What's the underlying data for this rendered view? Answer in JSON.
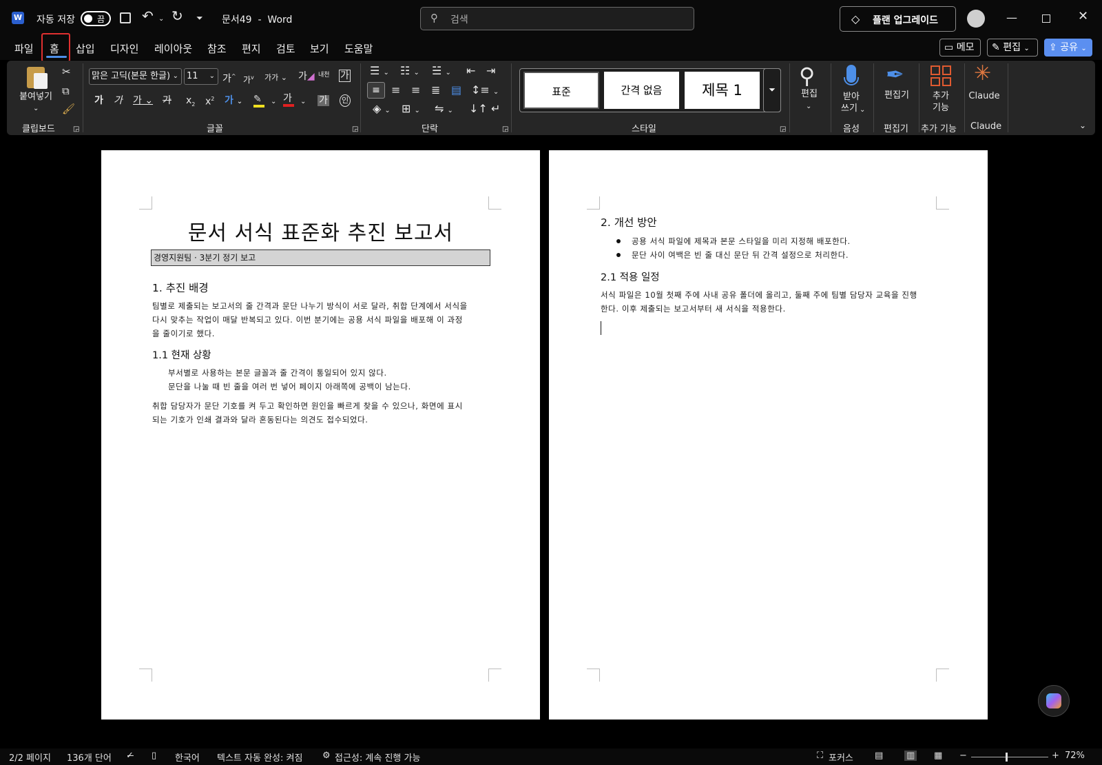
{
  "title_bar": {
    "autosave_label": "자동 저장",
    "autosave_state": "끔",
    "doc_title": "문서49  -  Word",
    "search_placeholder": "검색",
    "upgrade_label": "플랜 업그레이드"
  },
  "menu": {
    "tabs": [
      "파일",
      "홈",
      "삽입",
      "디자인",
      "레이아웃",
      "참조",
      "편지",
      "검토",
      "보기",
      "도움말"
    ],
    "active_tab": "홈",
    "memo_label": "메모",
    "edit_label": "편집",
    "share_label": "공유"
  },
  "ribbon": {
    "clipboard": {
      "paste_label": "붙여넣기",
      "group_label": "클립보드"
    },
    "font": {
      "font_name": "맑은 고딕(본문 한글)",
      "font_size": "11",
      "group_label": "글꼴"
    },
    "paragraph": {
      "group_label": "단락"
    },
    "styles": {
      "items": [
        "표준",
        "간격 없음",
        "제목 1"
      ],
      "group_label": "스타일"
    },
    "editing": {
      "label": "편집"
    },
    "dictate": {
      "label_line1": "받아",
      "label_line2": "쓰기",
      "group_label": "음성"
    },
    "editor": {
      "label": "편집기",
      "group_label": "편집기"
    },
    "addins": {
      "label_line1": "추가",
      "label_line2": "기능",
      "group_label": "추가 기능"
    },
    "claude": {
      "label": "Claude",
      "group_label": "Claude"
    }
  },
  "document": {
    "page1": {
      "title": "문서 서식 표준화 추진 보고서",
      "subtitle": "경영지원팀 · 3분기 정기 보고",
      "h1": "1. 추진 배경",
      "para1_lines": [
        "팀별로 제출되는 보고서의 줄 간격과 문단 나누기 방식이 서로 달라, 취합 단계에서 서식을",
        "다시 맞추는 작업이 매달 반복되고 있다. 이번 분기에는 공용 서식 파일을 배포해 이 과정",
        "을 줄이기로 했다."
      ],
      "h2": "1.1 현재 상황",
      "indented": [
        "부서별로 사용하는 본문 글꼴과 줄 간격이 통일되어 있지 않다.",
        "문단을 나눌 때 빈 줄을 여러 번 넣어 페이지 아래쪽에 공백이 남는다."
      ],
      "para2_lines": [
        "취합 담당자가 문단 기호를 켜 두고 확인하면 원인을 빠르게 찾을 수 있으나, 화면에 표시",
        "되는 기호가 인쇄 결과와 달라 혼동된다는 의견도 접수되었다."
      ]
    },
    "page2": {
      "h1": "2. 개선 방안",
      "bullets": [
        "공용 서식 파일에 제목과 본문 스타일을 미리 지정해 배포한다.",
        "문단 사이 여백은 빈 줄 대신 문단 뒤 간격 설정으로 처리한다."
      ],
      "h2": "2.1 적용 일정",
      "para_lines": [
        "서식 파일은 10월 첫째 주에 사내 공유 폴더에 올리고, 둘째 주에 팀별 담당자 교육을 진행",
        "한다. 이후 제출되는 보고서부터 새 서식을 적용한다."
      ]
    }
  },
  "status_bar": {
    "page": "2/2 페이지",
    "words": "136개 단어",
    "language": "한국어",
    "autocomplete": "텍스트 자동 완성: 켜짐",
    "accessibility": "접근성: 계속 진행 가능",
    "focus": "포커스",
    "zoom": "72%"
  },
  "colors": {
    "accent_blue": "#4d8fe8",
    "share_button": "#5b8ff0",
    "highlight_red": "#e03030",
    "word_icon": "#2b5fce"
  }
}
